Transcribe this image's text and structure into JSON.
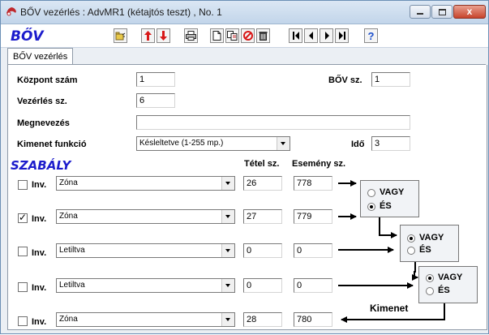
{
  "window": {
    "title": "BŐV vezérlés : AdvMR1 (kétajtós teszt) , No. 1",
    "close_glyph": "x"
  },
  "toolbar": {
    "brand": "BŐV",
    "buttons": [
      "open-icon",
      "arrow-up-icon",
      "arrow-down-icon",
      "print-icon",
      "new-icon",
      "copy-icon",
      "stop-icon",
      "delete-icon",
      "first-icon",
      "prev-icon",
      "next-icon",
      "last-icon",
      "help-icon"
    ]
  },
  "tab": {
    "label": "BŐV vezérlés"
  },
  "form": {
    "kozpont_label": "Központ szám",
    "kozpont_value": "1",
    "bov_label": "BŐV sz.",
    "bov_value": "1",
    "vezerles_label": "Vezérlés sz.",
    "vezerles_value": "6",
    "megnevezes_label": "Megnevezés",
    "megnevezes_value": "",
    "kimenet_funkcio_label": "Kimenet funkció",
    "kimenet_funkcio_value": "Késleltetve (1-255 mp.)",
    "ido_label": "Idő",
    "ido_value": "3"
  },
  "rules": {
    "title": "SZABÁLY",
    "tetel_header": "Tétel sz.",
    "esemeny_header": "Esemény sz.",
    "inv_label": "Inv.",
    "rows": [
      {
        "checked": false,
        "type": "Zóna",
        "tetel": "26",
        "esemeny": "778"
      },
      {
        "checked": true,
        "type": "Zóna",
        "tetel": "27",
        "esemeny": "779"
      },
      {
        "checked": false,
        "type": "Letiltva",
        "tetel": "0",
        "esemeny": "0"
      },
      {
        "checked": false,
        "type": "Letiltva",
        "tetel": "0",
        "esemeny": "0"
      },
      {
        "checked": false,
        "type": "Zóna",
        "tetel": "28",
        "esemeny": "780"
      }
    ],
    "logic_groups": [
      {
        "vagy": "VAGY",
        "es": "ÉS",
        "selected": "ÉS"
      },
      {
        "vagy": "VAGY",
        "es": "ÉS",
        "selected": "VAGY"
      },
      {
        "vagy": "VAGY",
        "es": "ÉS",
        "selected": "VAGY"
      }
    ],
    "kimenet_label": "Kimenet"
  }
}
